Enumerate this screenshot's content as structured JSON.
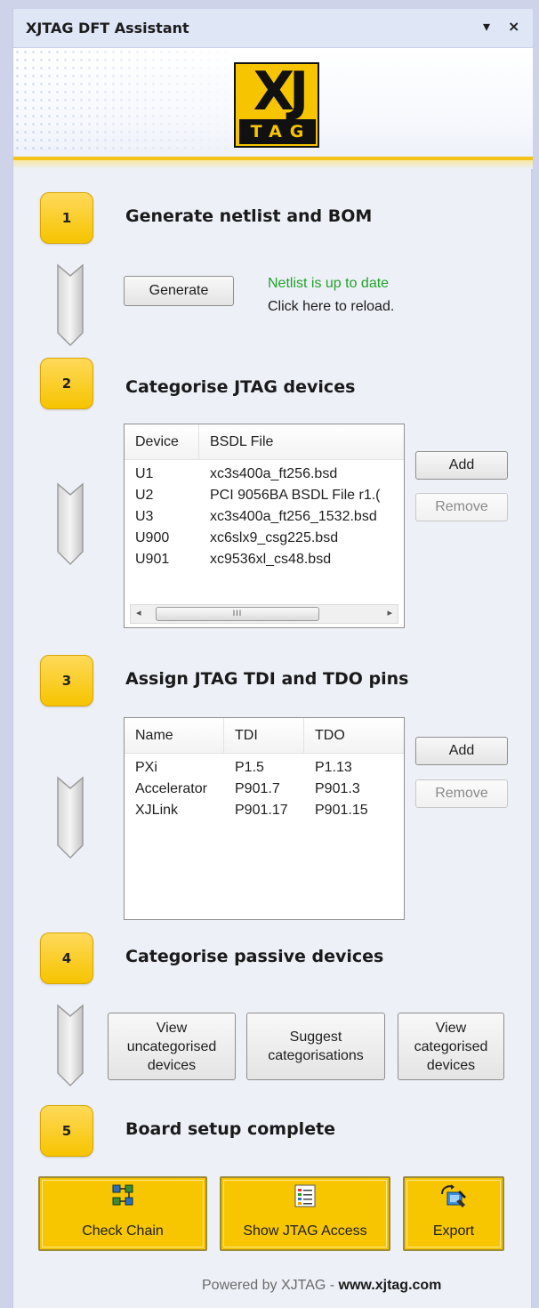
{
  "window": {
    "title": "XJTAG DFT Assistant",
    "menu_glyph": "▾",
    "close_glyph": "×",
    "logo_top": "XJ",
    "logo_bottom": "TAG"
  },
  "steps": [
    {
      "number": "1",
      "title": "Generate netlist and BOM"
    },
    {
      "number": "2",
      "title": "Categorise JTAG devices"
    },
    {
      "number": "3",
      "title": "Assign JTAG TDI and TDO pins"
    },
    {
      "number": "4",
      "title": "Categorise passive devices"
    },
    {
      "number": "5",
      "title": "Board setup complete"
    }
  ],
  "step1": {
    "generate_label": "Generate",
    "status": "Netlist is up to date",
    "reload": "Click here to reload."
  },
  "step2": {
    "columns": [
      "Device",
      "BSDL File"
    ],
    "rows": [
      [
        "U1",
        "xc3s400a_ft256.bsd"
      ],
      [
        "U2",
        "PCI 9056BA BSDL File r1.("
      ],
      [
        "U3",
        "xc3s400a_ft256_1532.bsd"
      ],
      [
        "U900",
        "xc6slx9_csg225.bsd"
      ],
      [
        "U901",
        "xc9536xl_cs48.bsd"
      ]
    ],
    "scroll_left": "◂",
    "scroll_right": "▸",
    "scroll_grip": "III",
    "add_label": "Add",
    "remove_label": "Remove"
  },
  "step3": {
    "columns": [
      "Name",
      "TDI",
      "TDO"
    ],
    "rows": [
      [
        "PXi",
        "P1.5",
        "P1.13"
      ],
      [
        "Accelerator",
        "P901.7",
        "P901.3"
      ],
      [
        "XJLink",
        "P901.17",
        "P901.15"
      ]
    ],
    "add_label": "Add",
    "remove_label": "Remove"
  },
  "step4": {
    "view_uncat": [
      "View",
      "uncategorised",
      "devices"
    ],
    "suggest": [
      "Suggest",
      "categorisations"
    ],
    "view_cat": [
      "View",
      "categorised",
      "devices"
    ]
  },
  "actions": {
    "check_chain": "Check Chain",
    "show_jtag_access": "Show JTAG Access",
    "export": "Export"
  },
  "footer": {
    "powered_by": "Powered by XJTAG - ",
    "url": "www.xjtag.com"
  },
  "colors": {
    "accent_yellow": "#f6c400",
    "status_green": "#22a22a",
    "panel_bg": "#eef0f8"
  }
}
